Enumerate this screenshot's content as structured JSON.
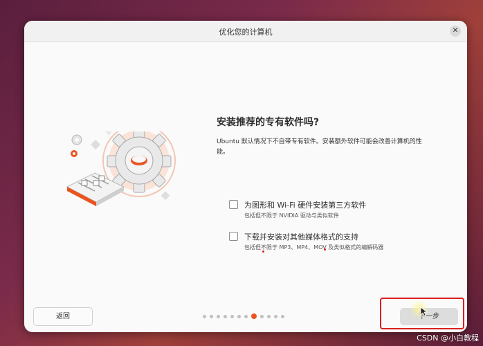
{
  "window": {
    "title": "优化您的计算机",
    "close_glyph": "✕"
  },
  "main": {
    "heading": "安装推荐的专有软件吗?",
    "description": "Ubuntu 默认情况下不自带专有软件。安装额外软件可能会改善计算机的性能。",
    "options": [
      {
        "label": "为图形和 Wi-Fi 硬件安装第三方软件",
        "sublabel": "包括但不限于 NVIDIA 驱动与类似软件",
        "checked": false
      },
      {
        "label": "下载并安装对其他媒体格式的支持",
        "sublabel": "包括但不限于 MP3、MP4、MOV 及类似格式的编解码器",
        "checked": false
      }
    ]
  },
  "footer": {
    "back_label": "返回",
    "next_label": "下一步",
    "page_dots_total": 12,
    "page_dots_active_index": 7
  },
  "watermark": "CSDN @小白教程",
  "colors": {
    "accent": "#e95420",
    "highlight_box": "#d92020",
    "window_bg": "#fafafa"
  },
  "icons": {
    "illustration": "gear-sliders-illustration",
    "close": "close-icon"
  }
}
